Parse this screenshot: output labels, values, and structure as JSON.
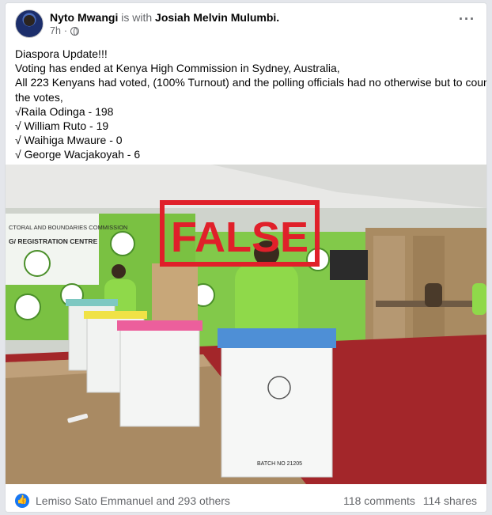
{
  "post": {
    "author": "Nyto Mwangi",
    "with_text": "is with",
    "tagged": "Josiah Melvin Mulumbi.",
    "time": "7h",
    "lines": [
      "Diaspora Update!!!",
      "Voting has ended at Kenya High Commission in Sydney, Australia,",
      "All 223 Kenyans had voted, (100% Turnout) and the polling officials had no otherwise but to count",
      "the votes,",
      "√Raila Odinga - 198",
      "√ William Ruto - 19",
      "√ Waihiga Mwaure - 0",
      "√ George Wacjakoyah - 6"
    ]
  },
  "photo": {
    "stamp": "FALSE",
    "banner_line1": "CTORAL AND BOUNDARIES COMMISSION",
    "banner_line2": "G/ REGISTRATION CENTRE",
    "box_label": "BATCH NO 21205",
    "colors": {
      "green": "#7ac142",
      "stamp_red": "#e0202a",
      "floor": "#a52a2a"
    }
  },
  "footer": {
    "reactors": "Lemiso Sato Emmanuel and 293 others",
    "comments": "118 comments",
    "shares": "114 shares"
  }
}
